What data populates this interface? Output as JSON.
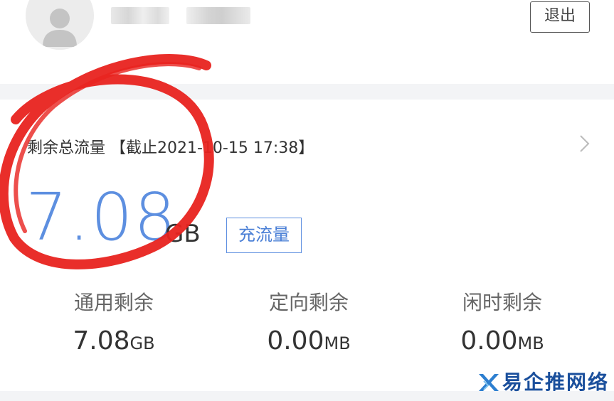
{
  "header": {
    "logout_label": "退出"
  },
  "summary": {
    "title": "剩余总流量 【截止2021-10-15 17:38】",
    "total_value": "7.08",
    "total_unit": "GB",
    "recharge_label": "充流量"
  },
  "stats": [
    {
      "label": "通用剩余",
      "value": "7.08",
      "unit": "GB"
    },
    {
      "label": "定向剩余",
      "value": "0.00",
      "unit": "MB"
    },
    {
      "label": "闲时剩余",
      "value": "0.00",
      "unit": "MB"
    }
  ],
  "watermark": {
    "text": "易企推网络"
  },
  "colors": {
    "accent": "#5d8fe0",
    "annotation": "#e8231f",
    "watermark": "#1a4f9c"
  },
  "icons": {
    "avatar": "user-silhouette-icon",
    "detail": "chevron-right-icon",
    "watermark_logo": "x-logo-icon"
  }
}
